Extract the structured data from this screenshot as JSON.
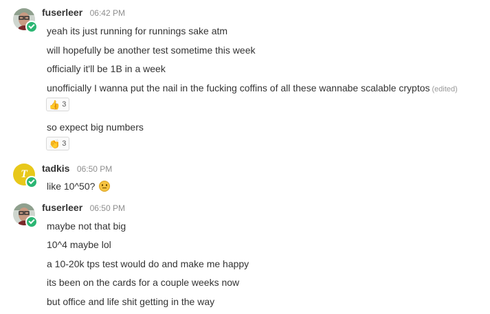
{
  "messages": [
    {
      "user": "fuserleer",
      "time": "06:42 PM",
      "avatar": "photo-avatar",
      "lines": [
        "yeah its just running for runnings sake atm",
        "will hopefully be another test sometime this week",
        "officially it'll be 1B in a week",
        "unofficially I wanna put the nail in the fucking coffins of all these wannabe scalable cryptos",
        "so expect big numbers"
      ],
      "edited_label": "(edited)",
      "reactions": [
        {
          "emoji": "👍",
          "icon": "thumbs-up-icon",
          "count": "3"
        },
        {
          "emoji": "👏",
          "icon": "clapping-hands-icon",
          "count": "3"
        }
      ]
    },
    {
      "user": "tadkis",
      "time": "06:50 PM",
      "avatar_letter": "T",
      "avatar_color": "#e8c81a",
      "lines": [
        "like 10^50?"
      ]
    },
    {
      "user": "fuserleer",
      "time": "06:50 PM",
      "avatar": "photo-avatar",
      "lines": [
        "maybe not that big",
        "10^4 maybe lol",
        "a 10-20k tps test would do and make me happy",
        "its been on the cards for a couple weeks now",
        "but office and life shit getting in the way"
      ]
    }
  ],
  "colors": {
    "online": "#2bb673",
    "username": "#333333",
    "timestamp": "#8e8e8e"
  }
}
